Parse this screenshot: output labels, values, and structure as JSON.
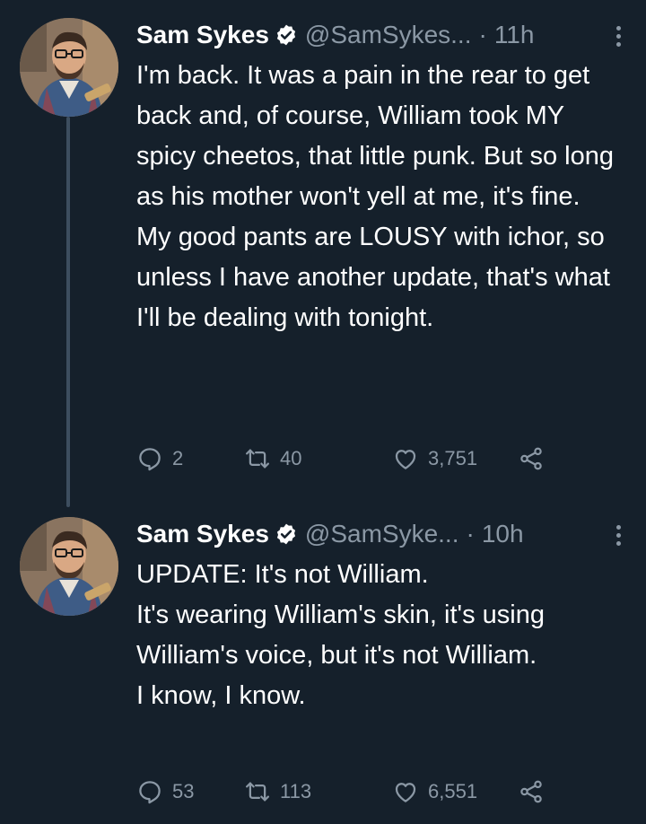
{
  "tweets": [
    {
      "author_name": "Sam Sykes",
      "handle": "@SamSykes...",
      "separator": "·",
      "time": "11h",
      "text_paragraphs": [
        "I'm back. It was a pain in the rear to get back and, of course, William took MY spicy cheetos, that little punk. But so long as his mother won't yell at me, it's fine.",
        "My good pants are LOUSY with ichor, so unless I have another update, that's what I'll be dealing with tonight."
      ],
      "replies": "2",
      "retweets": "40",
      "likes": "3,751"
    },
    {
      "author_name": "Sam Sykes",
      "handle": "@SamSyke...",
      "separator": "·",
      "time": "10h",
      "text_paragraphs": [
        "UPDATE: It's not William.",
        "It's wearing William's skin, it's using William's voice, but it's not William.",
        "I know, I know."
      ],
      "replies": "53",
      "retweets": "113",
      "likes": "6,551"
    }
  ],
  "colors": {
    "background": "#15202b",
    "text_primary": "#ffffff",
    "text_secondary": "#8b98a5",
    "thread_line": "#3d4e5f"
  },
  "icons": {
    "verified": "verified-badge-icon",
    "more": "more-vertical-icon",
    "reply": "reply-icon",
    "retweet": "retweet-icon",
    "like": "heart-icon",
    "share": "share-icon"
  }
}
